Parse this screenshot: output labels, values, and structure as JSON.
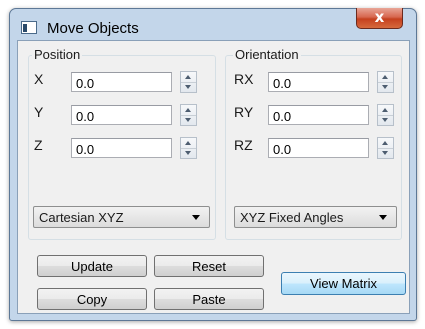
{
  "window": {
    "title": "Move Objects",
    "close_label": "x",
    "icon": "app-window-icon"
  },
  "position": {
    "legend": "Position",
    "fields": [
      {
        "label": "X",
        "value": "0.0"
      },
      {
        "label": "Y",
        "value": "0.0"
      },
      {
        "label": "Z",
        "value": "0.0"
      }
    ],
    "coordinate_system": "Cartesian XYZ"
  },
  "orientation": {
    "legend": "Orientation",
    "fields": [
      {
        "label": "RX",
        "value": "0.0"
      },
      {
        "label": "RY",
        "value": "0.0"
      },
      {
        "label": "RZ",
        "value": "0.0"
      }
    ],
    "angle_convention": "XYZ Fixed Angles"
  },
  "buttons": {
    "update": "Update",
    "reset": "Reset",
    "copy": "Copy",
    "paste": "Paste",
    "view_matrix": "View Matrix"
  }
}
